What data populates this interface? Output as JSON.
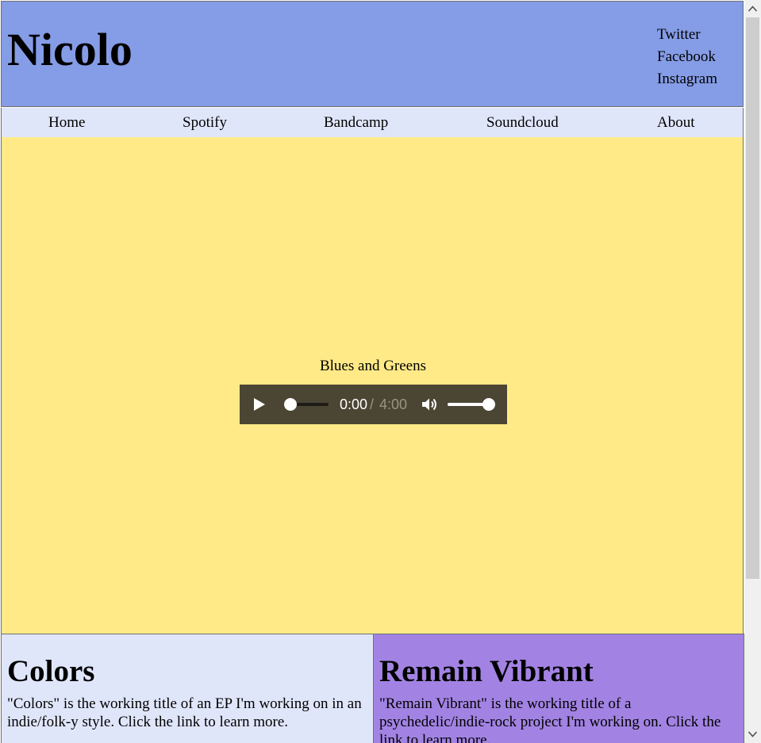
{
  "header": {
    "title": "Nicolo",
    "social": [
      "Twitter",
      "Facebook",
      "Instagram"
    ]
  },
  "nav": {
    "items": [
      "Home",
      "Spotify",
      "Bandcamp",
      "Soundcloud",
      "About"
    ]
  },
  "player": {
    "track_title": "Blues and Greens",
    "current_time": "0:00",
    "separator": "/",
    "total_time": "4:00",
    "progress": 0,
    "volume": 1
  },
  "panels": [
    {
      "title": "Colors",
      "text": "\"Colors\" is the working title of an EP I'm working on in an indie/folk-y style. Click the link to learn more."
    },
    {
      "title": "Remain Vibrant",
      "text": "\"Remain Vibrant\" is the working title of a psychedelic/indie-rock project I'm working on. Click the link to learn more."
    }
  ],
  "colors": {
    "header_bg": "#859ce6",
    "nav_bg": "#e0e6fa",
    "main_bg": "#ffea87",
    "player_bg": "#4b4634",
    "panel_left_bg": "#e0e6fa",
    "panel_right_bg": "#a283e3"
  }
}
